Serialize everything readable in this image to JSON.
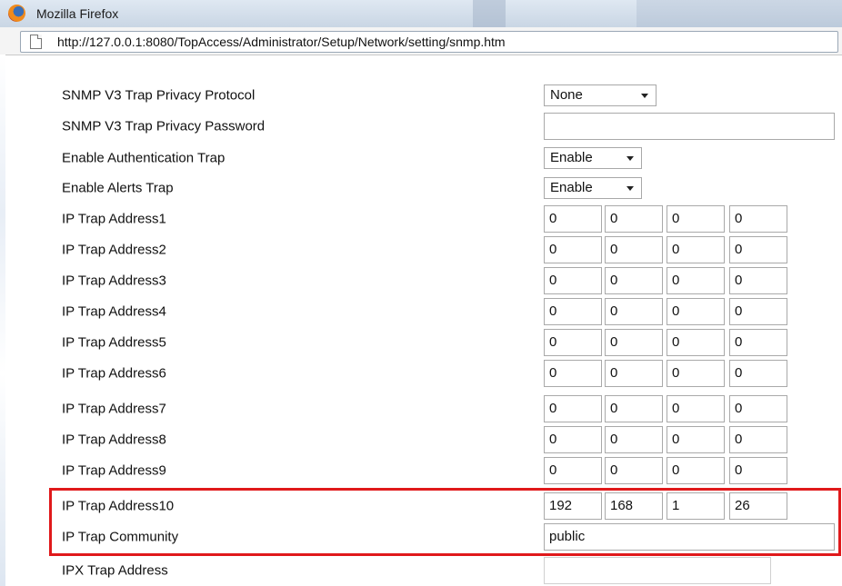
{
  "window": {
    "title": "Mozilla Firefox"
  },
  "address": {
    "url": "http://127.0.0.1:8080/TopAccess/Administrator/Setup/Network/setting/snmp.htm"
  },
  "form": {
    "privacy_protocol": {
      "label": "SNMP V3 Trap Privacy Protocol",
      "value": "None"
    },
    "privacy_password": {
      "label": "SNMP V3 Trap Privacy Password",
      "value": ""
    },
    "auth_trap": {
      "label": "Enable Authentication Trap",
      "value": "Enable"
    },
    "alerts_trap": {
      "label": "Enable Alerts Trap",
      "value": "Enable"
    },
    "ip_traps": [
      {
        "label": "IP Trap Address1",
        "octets": [
          "0",
          "0",
          "0",
          "0"
        ]
      },
      {
        "label": "IP Trap Address2",
        "octets": [
          "0",
          "0",
          "0",
          "0"
        ]
      },
      {
        "label": "IP Trap Address3",
        "octets": [
          "0",
          "0",
          "0",
          "0"
        ]
      },
      {
        "label": "IP Trap Address4",
        "octets": [
          "0",
          "0",
          "0",
          "0"
        ]
      },
      {
        "label": "IP Trap Address5",
        "octets": [
          "0",
          "0",
          "0",
          "0"
        ]
      },
      {
        "label": "IP Trap Address6",
        "octets": [
          "0",
          "0",
          "0",
          "0"
        ]
      },
      {
        "label": "IP Trap Address7",
        "octets": [
          "0",
          "0",
          "0",
          "0"
        ]
      },
      {
        "label": "IP Trap Address8",
        "octets": [
          "0",
          "0",
          "0",
          "0"
        ]
      },
      {
        "label": "IP Trap Address9",
        "octets": [
          "0",
          "0",
          "0",
          "0"
        ]
      },
      {
        "label": "IP Trap Address10",
        "octets": [
          "192",
          "168",
          "1",
          "26"
        ]
      }
    ],
    "community": {
      "label": "IP Trap Community",
      "value": "public"
    },
    "ipx_trap": {
      "label": "IPX Trap Address",
      "value": ""
    }
  },
  "colors": {
    "highlight": "#e0191b"
  },
  "icons": {
    "app": "firefox-icon",
    "page": "page-icon",
    "dropdown": "chevron-down-icon"
  }
}
